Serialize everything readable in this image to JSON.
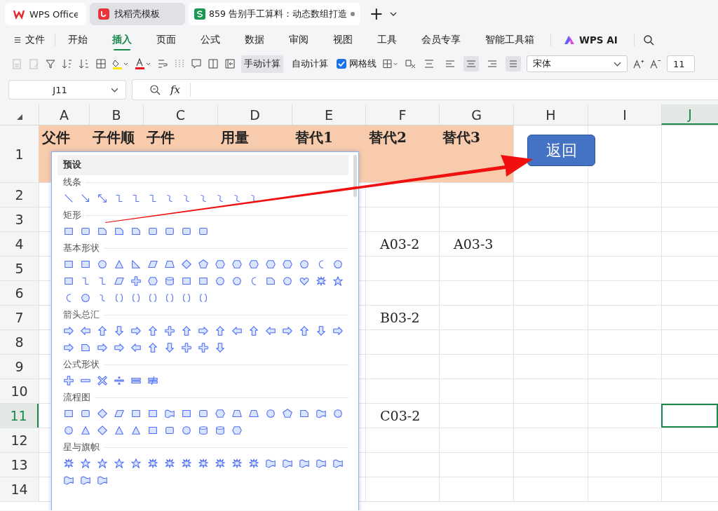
{
  "tabs": [
    {
      "label": "WPS Office",
      "kind": "home",
      "selected": false
    },
    {
      "label": "找稻壳模板",
      "kind": "template",
      "selected": false
    },
    {
      "label": "859 告别手工算料：动态数组打造",
      "kind": "sheet",
      "selected": true
    }
  ],
  "new_tab": "+",
  "menu": [
    {
      "label": "文件",
      "kind": "file",
      "selected": false
    },
    {
      "label": "开始",
      "kind": "plain",
      "selected": false
    },
    {
      "label": "插入",
      "kind": "plain",
      "selected": true
    },
    {
      "label": "页面",
      "kind": "plain",
      "selected": false
    },
    {
      "label": "公式",
      "kind": "plain",
      "selected": false
    },
    {
      "label": "数据",
      "kind": "plain",
      "selected": false
    },
    {
      "label": "审阅",
      "kind": "plain",
      "selected": false
    },
    {
      "label": "视图",
      "kind": "plain",
      "selected": false
    },
    {
      "label": "工具",
      "kind": "plain",
      "selected": false
    },
    {
      "label": "会员专享",
      "kind": "plain",
      "selected": false
    },
    {
      "label": "智能工具箱",
      "kind": "plain",
      "selected": false
    },
    {
      "label": "WPS AI",
      "kind": "ai",
      "selected": false
    }
  ],
  "toolbar": {
    "calc_buttons": [
      {
        "label": "手动计算",
        "selected": true
      },
      {
        "label": "自动计算",
        "selected": false
      }
    ],
    "gridlines": {
      "label": "网格线",
      "checked": true
    },
    "align_buttons": [
      {
        "selected": false
      },
      {
        "selected": false
      },
      {
        "selected": true
      },
      {
        "selected": false
      },
      {
        "selected": true
      }
    ],
    "font": "宋体",
    "font_size": "11"
  },
  "formula_bar": {
    "name_box": "J11",
    "fx": "fx"
  },
  "sheet": {
    "columns": [
      {
        "label": "A",
        "selected": false
      },
      {
        "label": "B",
        "selected": false
      },
      {
        "label": "C",
        "selected": false
      },
      {
        "label": "D",
        "selected": false
      },
      {
        "label": "E",
        "selected": false
      },
      {
        "label": "F",
        "selected": false
      },
      {
        "label": "G",
        "selected": false
      },
      {
        "label": "H",
        "selected": false
      },
      {
        "label": "I",
        "selected": false
      },
      {
        "label": "J",
        "selected": true
      }
    ],
    "rows": [
      {
        "label": "1",
        "kind": "header",
        "selected": false,
        "cells": [
          "父件",
          "子件顺",
          "子件",
          "用量",
          "替代1",
          "替代2",
          "替代3"
        ]
      },
      {
        "label": "2",
        "kind": "data",
        "selected": false,
        "cells": []
      },
      {
        "label": "3",
        "kind": "data",
        "selected": false,
        "cells": []
      },
      {
        "label": "4",
        "kind": "data",
        "selected": false,
        "cells": [
          "",
          "",
          "",
          "",
          "",
          "A03-2",
          "A03-3"
        ]
      },
      {
        "label": "5",
        "kind": "data",
        "selected": false,
        "cells": []
      },
      {
        "label": "6",
        "kind": "data",
        "selected": false,
        "cells": []
      },
      {
        "label": "7",
        "kind": "data",
        "selected": false,
        "cells": [
          "",
          "",
          "",
          "",
          "",
          "B03-2"
        ]
      },
      {
        "label": "8",
        "kind": "data",
        "selected": false,
        "cells": []
      },
      {
        "label": "9",
        "kind": "data",
        "selected": false,
        "cells": []
      },
      {
        "label": "10",
        "kind": "data",
        "selected": false,
        "cells": []
      },
      {
        "label": "11",
        "kind": "data",
        "selected": true,
        "cells": [
          "",
          "",
          "",
          "",
          "",
          "C03-2"
        ]
      },
      {
        "label": "12",
        "kind": "data",
        "selected": false,
        "cells": []
      },
      {
        "label": "13",
        "kind": "data",
        "selected": false,
        "cells": []
      },
      {
        "label": "14",
        "kind": "data",
        "selected": false,
        "cells": []
      }
    ],
    "return_button": "返回"
  },
  "shape_panel": {
    "title": "预设",
    "sections": [
      {
        "label": "线条"
      },
      {
        "label": "矩形"
      },
      {
        "label": "基本形状"
      },
      {
        "label": "箭头总汇"
      },
      {
        "label": "公式形状"
      },
      {
        "label": "流程图"
      },
      {
        "label": "星与旗帜"
      }
    ]
  }
}
